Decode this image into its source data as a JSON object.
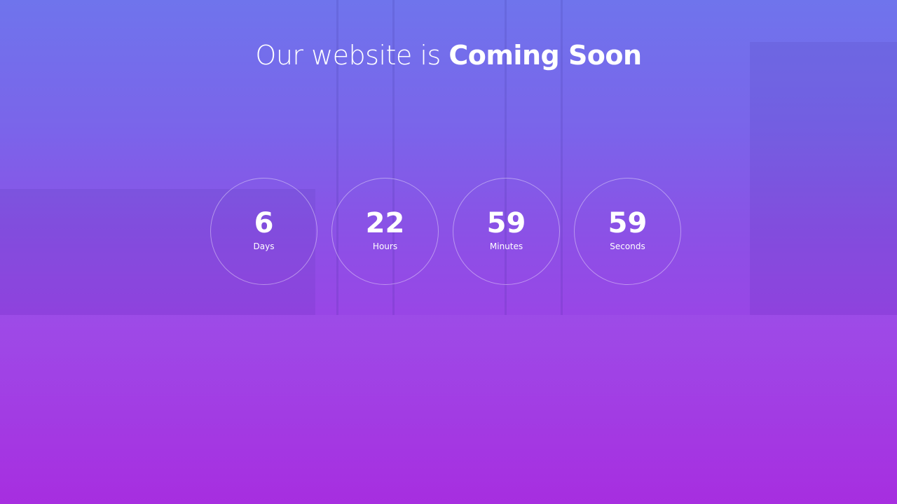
{
  "headline": {
    "prefix": "Our website is",
    "highlight": "Coming Soon"
  },
  "countdown": [
    {
      "value": "6",
      "label": "Days"
    },
    {
      "value": "22",
      "label": "Hours"
    },
    {
      "value": "59",
      "label": "Minutes"
    },
    {
      "value": "59",
      "label": "Seconds"
    }
  ],
  "colors": {
    "gradient_top": "#6f74ec",
    "gradient_bottom": "#a72ee0",
    "text": "#ffffff"
  }
}
